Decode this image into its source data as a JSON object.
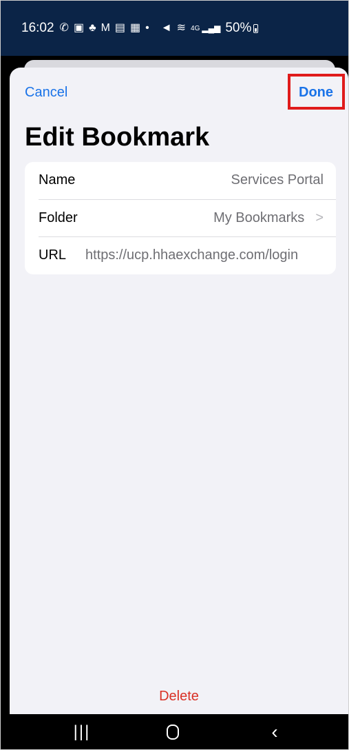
{
  "status_bar": {
    "time": "16:02",
    "icons": [
      "whatsapp-icon",
      "teams-icon",
      "teams-alt-icon",
      "gmail-icon",
      "outlook-icon",
      "outlook-alt-icon",
      "dot-icon",
      "mute-icon",
      "wifi-icon",
      "signal-icon"
    ],
    "network": "4G",
    "battery": "50%"
  },
  "header": {
    "cancel_label": "Cancel",
    "done_label": "Done",
    "title": "Edit Bookmark"
  },
  "form": {
    "name_label": "Name",
    "name_value": "Services Portal",
    "folder_label": "Folder",
    "folder_value": "My Bookmarks",
    "url_label": "URL",
    "url_value": "https://ucp.hhaexchange.com/login"
  },
  "footer": {
    "delete_label": "Delete"
  },
  "nav_bar": {
    "icons": [
      "recents-icon",
      "home-icon",
      "back-icon"
    ]
  },
  "colors": {
    "status_bar_bg": "#0b2447",
    "accent": "#1a73e8",
    "destructive": "#d93025",
    "highlight_box": "#e01b1b",
    "sheet_bg": "#f2f2f7"
  }
}
